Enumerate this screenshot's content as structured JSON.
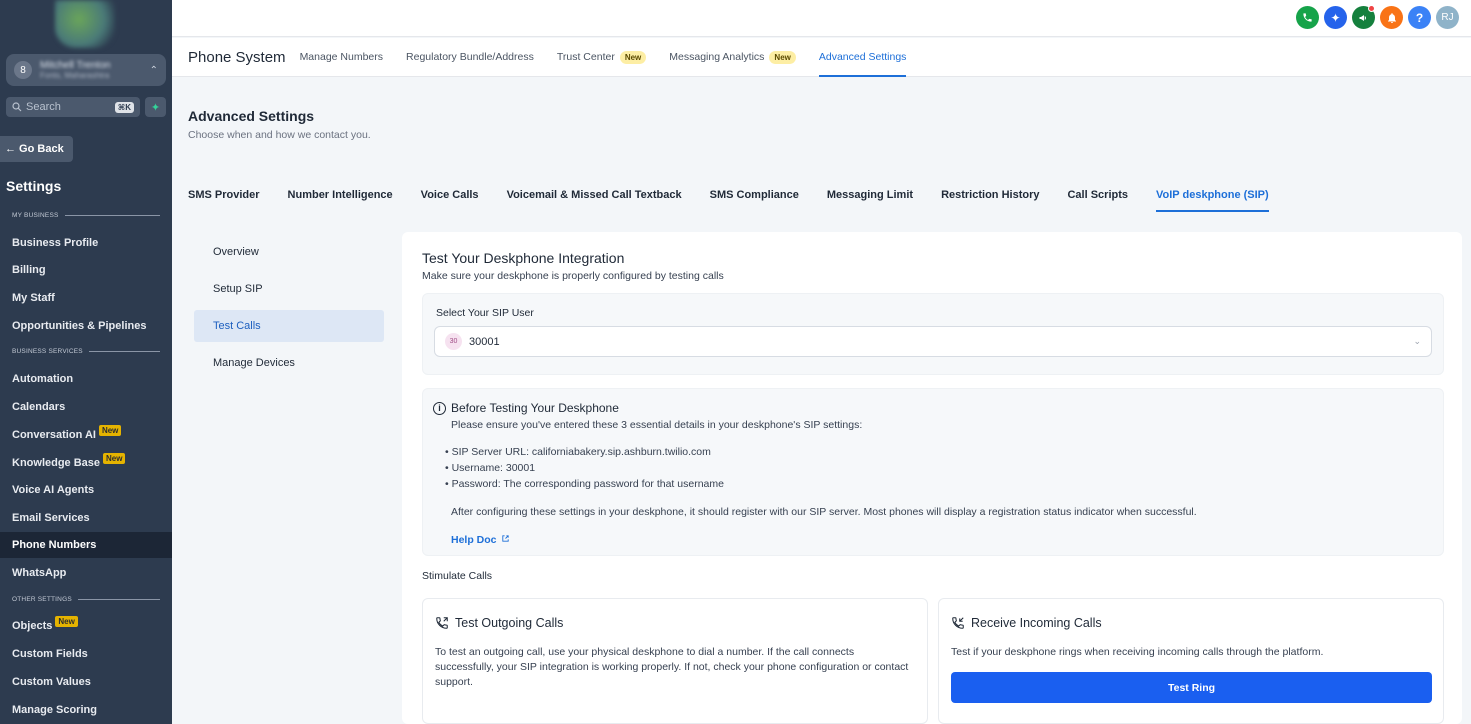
{
  "sidebar": {
    "account_name": "Mitchell Trenton",
    "account_location": "Fonts, Maharashtra",
    "account_avatar": "8",
    "search_placeholder": "Search",
    "search_shortcut": "⌘K",
    "back_label": "← Go Back",
    "title": "Settings",
    "sections": {
      "my_business": "MY BUSINESS",
      "business_services": "BUSINESS SERVICES",
      "other_settings": "OTHER SETTINGS"
    },
    "items": {
      "business_profile": "Business Profile",
      "billing": "Billing",
      "my_staff": "My Staff",
      "opportunities": "Opportunities & Pipelines",
      "automation": "Automation",
      "calendars": "Calendars",
      "conversation_ai": "Conversation AI",
      "knowledge_base": "Knowledge Base",
      "voice_ai_agents": "Voice AI Agents",
      "email_services": "Email Services",
      "phone_numbers": "Phone Numbers",
      "whatsapp": "WhatsApp",
      "objects": "Objects",
      "custom_fields": "Custom Fields",
      "custom_values": "Custom Values",
      "manage_scoring": "Manage Scoring"
    },
    "new_badge": "New"
  },
  "topbar": {
    "user_initials": "RJ",
    "icons": [
      {
        "name": "phone-icon",
        "color": "#16a34a"
      },
      {
        "name": "magic-icon",
        "color": "#2563eb"
      },
      {
        "name": "megaphone-icon",
        "color": "#15803d"
      },
      {
        "name": "bell-icon",
        "color": "#f97316"
      },
      {
        "name": "help-icon",
        "color": "#3b82f6"
      }
    ],
    "help_glyph": "?"
  },
  "subnav": {
    "brand": "Phone System",
    "items": [
      "Manage Numbers",
      "Regulatory Bundle/Address",
      "Trust Center",
      "Messaging Analytics",
      "Advanced Settings"
    ],
    "badge": "New"
  },
  "page": {
    "title": "Advanced Settings",
    "subtitle": "Choose when and how we contact you."
  },
  "tabs": [
    "SMS Provider",
    "Number Intelligence",
    "Voice Calls",
    "Voicemail & Missed Call Textback",
    "SMS Compliance",
    "Messaging Limit",
    "Restriction History",
    "Call Scripts",
    "VoIP deskphone (SIP)"
  ],
  "left_menu": [
    "Overview",
    "Setup SIP",
    "Test Calls",
    "Manage Devices"
  ],
  "card": {
    "title": "Test Your Deskphone Integration",
    "subtitle": "Make sure your deskphone is properly configured by testing calls",
    "select_label": "Select Your SIP User",
    "select_avatar": "30",
    "select_value": "30001",
    "info": {
      "title": "Before Testing Your Deskphone",
      "intro": "Please ensure you've entered these 3 essential details in your deskphone's SIP settings:",
      "bullet1": "• SIP Server URL: californiabakery.sip.ashburn.twilio.com",
      "bullet2": "• Username: 30001",
      "bullet3": "• Password: The corresponding password for that username",
      "after": "After configuring these settings in your deskphone, it should register with our SIP server. Most phones will display a registration status indicator when successful.",
      "help": "Help Doc"
    },
    "stimulate": "Stimulate Calls",
    "outgoing": {
      "title": "Test Outgoing Calls",
      "text": "To test an outgoing call, use your physical deskphone to dial a number. If the call connects successfully, your SIP integration is working properly. If not, check your phone configuration or contact support."
    },
    "incoming": {
      "title": "Receive Incoming Calls",
      "text": "Test if your deskphone rings when receiving incoming calls through the platform.",
      "button": "Test Ring"
    }
  }
}
